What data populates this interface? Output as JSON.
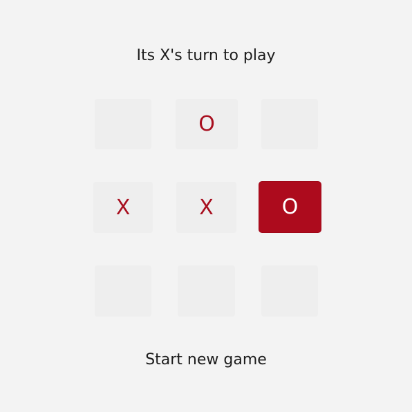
{
  "status": {
    "text": "Its X's turn to play"
  },
  "board": {
    "cells": [
      "",
      "O",
      "",
      "X",
      "X",
      "O",
      "",
      "",
      ""
    ],
    "selected_index": 5
  },
  "actions": {
    "new_game_label": "Start new game"
  },
  "colors": {
    "background": "#f3f3f3",
    "cell": "#eeeeee",
    "accent": "#ad0b1d",
    "mark": "#a80f1f"
  }
}
